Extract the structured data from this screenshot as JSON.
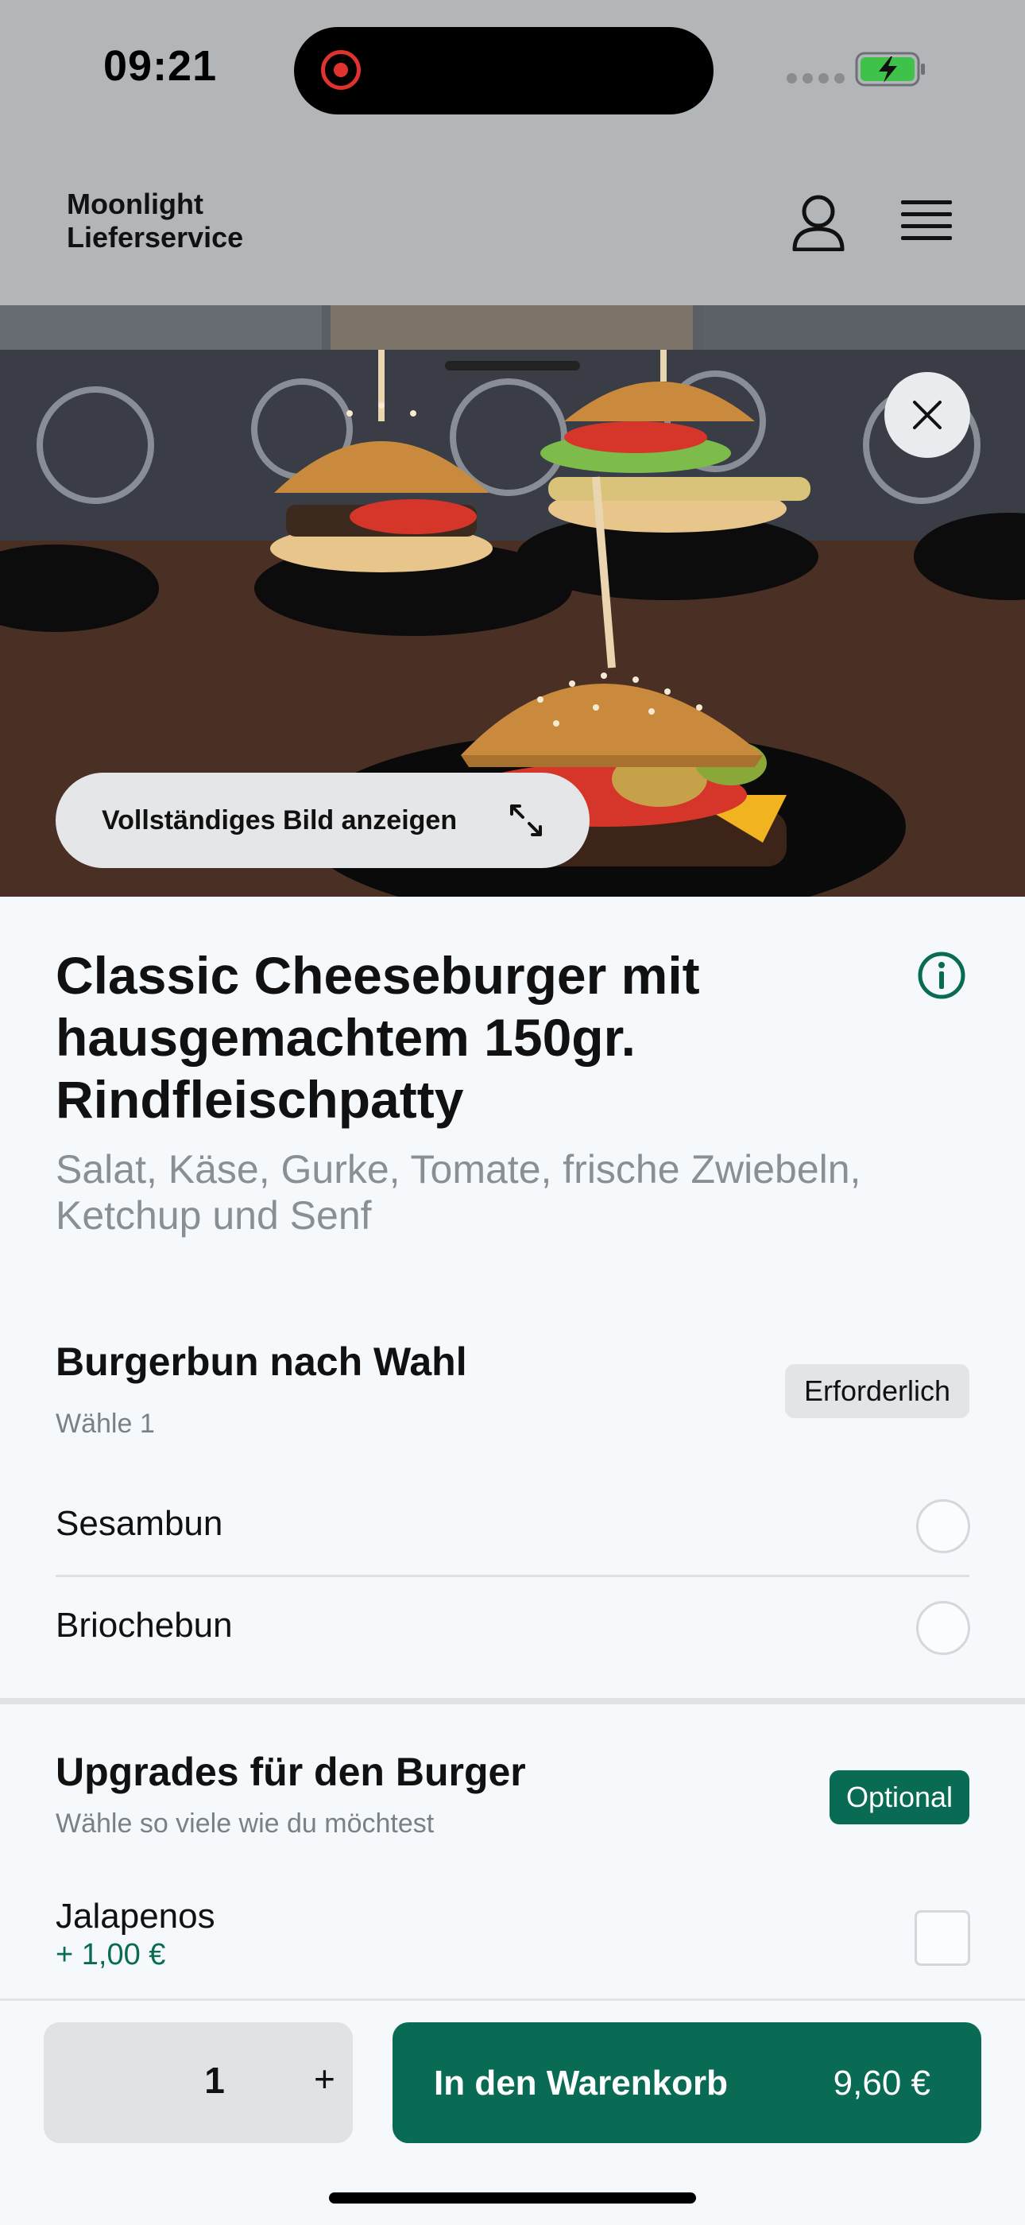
{
  "status_bar": {
    "time": "09:21"
  },
  "header": {
    "brand_line1": "Moonlight",
    "brand_line2": "Lieferservice"
  },
  "hero": {
    "full_image_label": "Vollständiges Bild anzeigen"
  },
  "product": {
    "title": "Classic Cheeseburger mit hausgemachtem 150gr. Rindfleischpatty",
    "description": "Salat, Käse, Gurke, Tomate, frische Zwiebeln, Ketchup und Senf"
  },
  "bun_section": {
    "title": "Burgerbun nach Wahl",
    "subtitle": "Wähle 1",
    "badge": "Erforderlich",
    "options": [
      {
        "label": "Sesambun",
        "selected": false
      },
      {
        "label": "Briochebun",
        "selected": false
      }
    ]
  },
  "upgrades_section": {
    "title": "Upgrades für den Burger",
    "subtitle": "Wähle so viele wie du möchtest",
    "badge": "Optional",
    "options": [
      {
        "label": "Jalapenos",
        "price": "+ 1,00 €",
        "checked": false
      }
    ]
  },
  "bottom_bar": {
    "quantity": "1",
    "plus": "+",
    "cart_label": "In den Warenkorb",
    "cart_price": "9,60 €"
  },
  "colors": {
    "accent": "#0a6b54",
    "header_bg": "#b3b6b9",
    "page_bg": "#f5f9fc"
  }
}
